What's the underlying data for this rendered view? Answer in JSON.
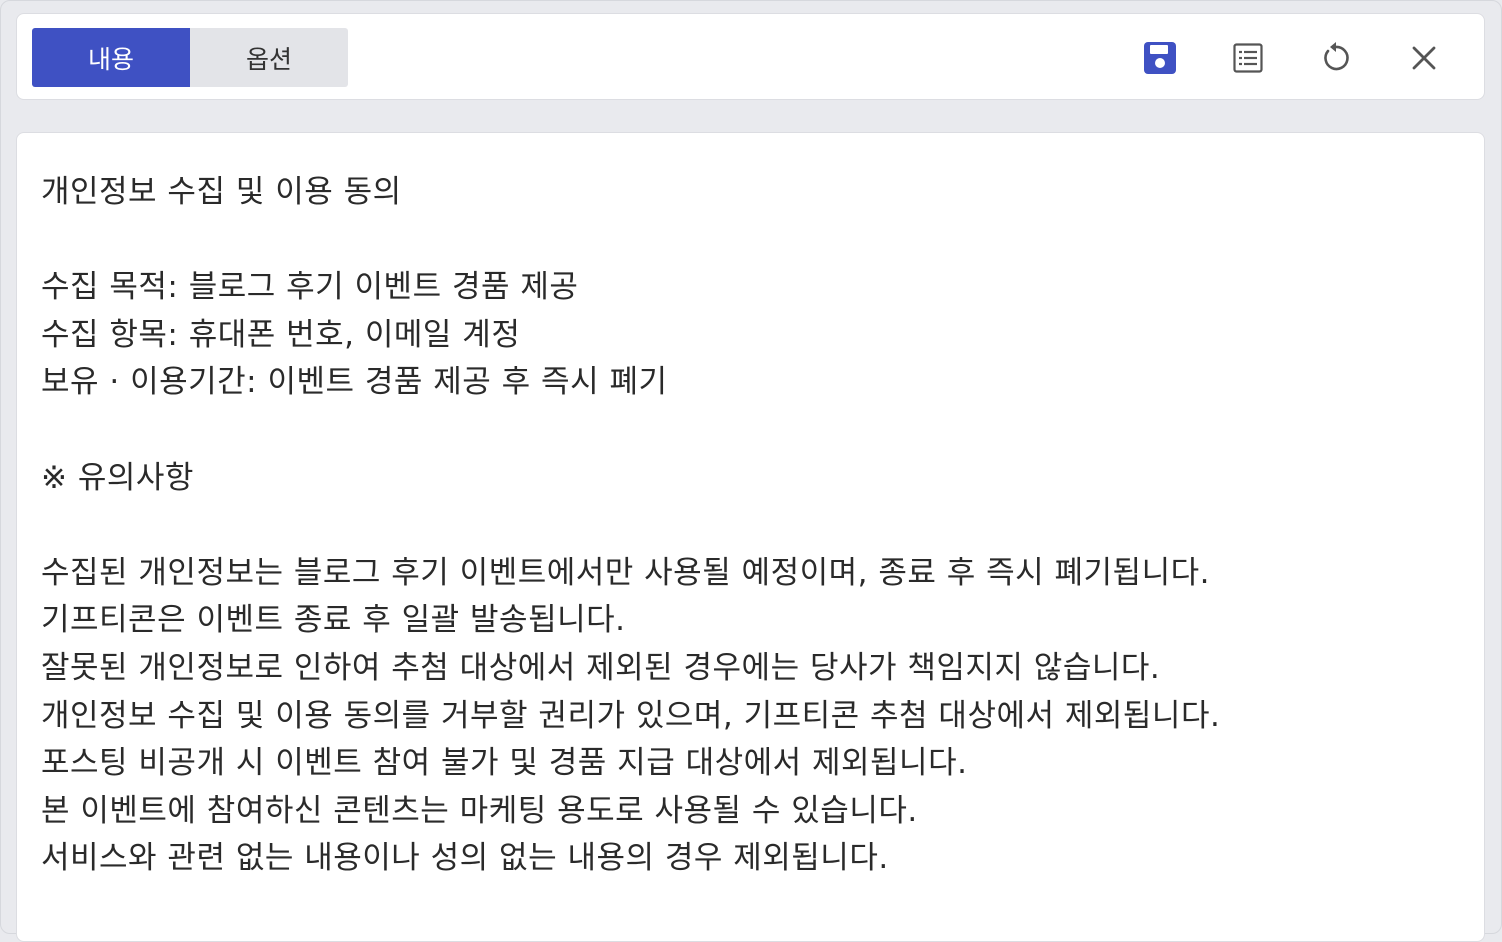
{
  "toolbar": {
    "tabs": [
      {
        "label": "내용",
        "active": true
      },
      {
        "label": "옵션",
        "active": false
      }
    ],
    "icons": [
      "save-icon",
      "list-icon",
      "refresh-icon",
      "close-icon"
    ],
    "accent_color": "#3f51c3"
  },
  "editor": {
    "lines": [
      "개인정보 수집 및 이용 동의",
      "",
      "수집 목적: 블로그 후기 이벤트 경품 제공",
      "수집 항목: 휴대폰 번호, 이메일 계정",
      "보유 · 이용기간: 이벤트 경품 제공 후 즉시 폐기",
      "",
      "※ 유의사항",
      "",
      "수집된 개인정보는 블로그 후기 이벤트에서만 사용될 예정이며, 종료 후 즉시 폐기됩니다.",
      "기프티콘은 이벤트 종료 후 일괄 발송됩니다.",
      "잘못된 개인정보로 인하여 추첨 대상에서 제외된 경우에는 당사가 책임지지 않습니다.",
      "개인정보 수집 및 이용 동의를 거부할 권리가 있으며, 기프티콘 추첨 대상에서 제외됩니다.",
      "포스팅 비공개 시 이벤트 참여 불가 및 경품 지급 대상에서 제외됩니다.",
      "본 이벤트에 참여하신 콘텐츠는 마케팅 용도로 사용될 수 있습니다.",
      "서비스와 관련 없는 내용이나 성의 없는 내용의 경우 제외됩니다."
    ]
  }
}
